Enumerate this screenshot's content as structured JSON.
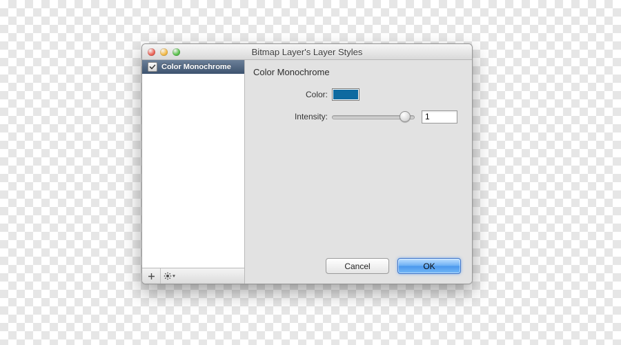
{
  "window": {
    "title": "Bitmap Layer's Layer Styles"
  },
  "sidebar": {
    "items": [
      {
        "label": "Color Monochrome",
        "checked": true
      }
    ],
    "footer": {
      "add_tooltip": "Add",
      "actions_tooltip": "Actions"
    }
  },
  "panel": {
    "title": "Color Monochrome",
    "color_label": "Color:",
    "color_value": "#0e6aa0",
    "intensity_label": "Intensity:",
    "intensity_value": "1",
    "intensity_fraction": 0.92
  },
  "buttons": {
    "cancel": "Cancel",
    "ok": "OK"
  }
}
